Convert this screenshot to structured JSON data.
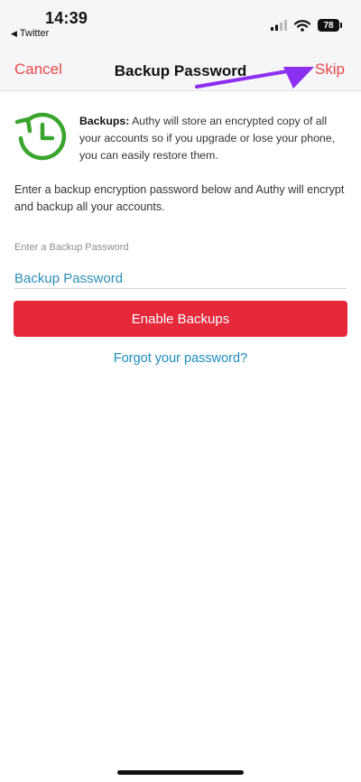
{
  "status_bar": {
    "time": "14:39",
    "back_app": "Twitter",
    "battery": "78"
  },
  "nav": {
    "cancel_label": "Cancel",
    "title": "Backup Password",
    "skip_label": "Skip"
  },
  "info": {
    "bold": "Backups:",
    "text": " Authy will store an encrypted copy of all your accounts so if you upgrade or lose your phone, you can easily restore them."
  },
  "description": "Enter a backup encryption password below and Authy will encrypt and backup all your accounts.",
  "password_field": {
    "label": "Enter a Backup Password",
    "placeholder": "Backup Password",
    "value": ""
  },
  "enable_button": {
    "label": "Enable Backups"
  },
  "forgot_link": {
    "label": "Forgot your password?"
  },
  "colors": {
    "accent_red": "#e5283a",
    "nav_red": "#e64a4a",
    "link_blue": "#1c8cbf",
    "icon_green": "#3aa52c",
    "annotation_purple": "#8b2ff0"
  },
  "icons": {
    "back": "back-triangle-icon",
    "signal": "cellular-signal-icon",
    "wifi": "wifi-icon",
    "battery": "battery-icon",
    "backup": "backup-history-icon",
    "annotation": "purple-arrow-annotation"
  }
}
